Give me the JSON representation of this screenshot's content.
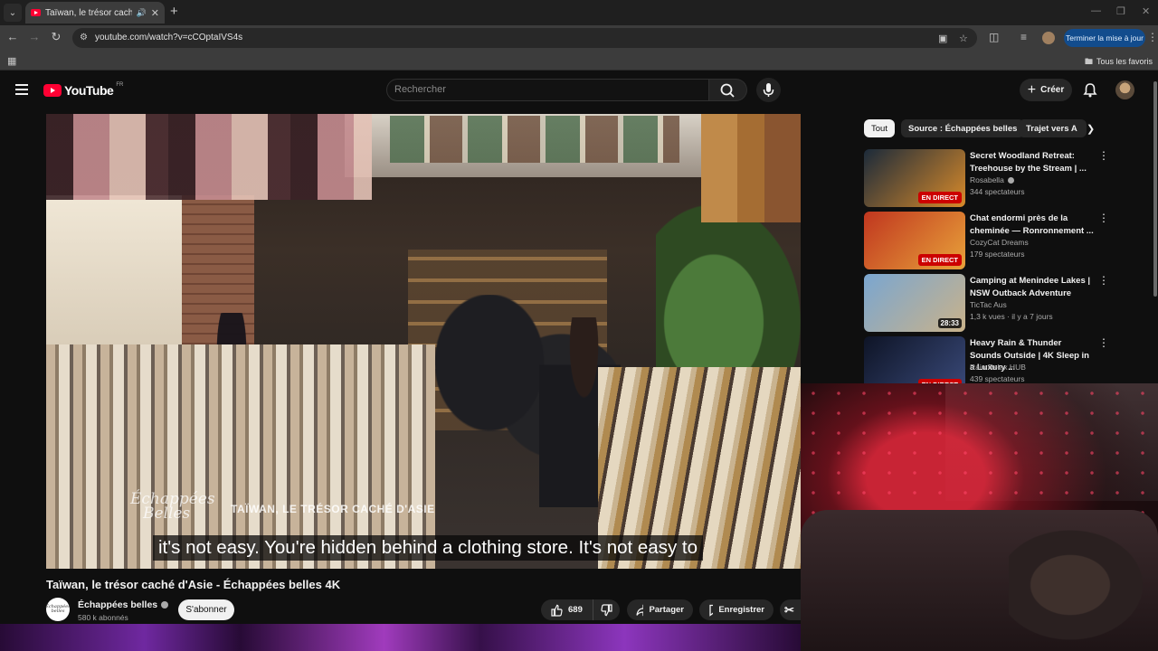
{
  "browser": {
    "tab_title": "Taïwan, le trésor caché d'Asie",
    "url": "youtube.com/watch?v=cCOptaIVS4s",
    "update_button": "Terminer la mise à jour",
    "all_bookmarks": "Tous les favoris"
  },
  "youtube": {
    "logo_text": "YouTube",
    "country": "FR",
    "search_placeholder": "Rechercher",
    "create_label": "Créer"
  },
  "video": {
    "overlay_logo_line1": "Échappées",
    "overlay_logo_line2": "Belles",
    "overlay_title": "TAÏWAN, LE TRÉSOR CACHÉ D'ASIE",
    "caption": "it's not easy. You're hidden behind a clothing store. It's not easy to",
    "title": "Taïwan, le trésor caché d'Asie - Échappées belles 4K",
    "channel_name": "Échappées belles",
    "channel_avatar_text": "Échappées belles",
    "subscribers": "580 k abonnés",
    "subscribe_label": "S'abonner",
    "like_count": "689",
    "share_label": "Partager",
    "save_label": "Enregistrer"
  },
  "chips": [
    "Tout",
    "Source : Échappées belles",
    "Trajet vers A"
  ],
  "recommendations": [
    {
      "title": "Secret Woodland Retreat: Treehouse by the Stream | ...",
      "channel": "Rosabella",
      "verified": true,
      "meta": "344 spectateurs",
      "badge": "EN DIRECT",
      "badge_type": "live",
      "thumb_colors": [
        "#1b2a3a",
        "#d88a2a"
      ]
    },
    {
      "title": "Chat endormi près de la cheminée — Ronronnement ...",
      "channel": "CozyCat Dreams",
      "verified": false,
      "meta": "179 spectateurs",
      "badge": "EN DIRECT",
      "badge_type": "live",
      "thumb_colors": [
        "#c0361f",
        "#e8a23a"
      ]
    },
    {
      "title": "Camping at Menindee Lakes | NSW Outback Adventure",
      "channel": "TicTac Aus",
      "verified": false,
      "meta": "1,3 k vues · il y a 7 jours",
      "badge": "28:33",
      "badge_type": "duration",
      "thumb_colors": [
        "#7aa6d0",
        "#c9b28a"
      ]
    },
    {
      "title": "Heavy Rain & Thunder Sounds Outside | 4K Sleep in a Luxury ...",
      "channel": "Rain Relax HUB",
      "verified": false,
      "meta": "439 spectateurs",
      "badge": "EN DIRECT",
      "badge_type": "live",
      "thumb_colors": [
        "#0e1426",
        "#3a4a7a"
      ]
    }
  ],
  "colors": {
    "yt_red": "#ff0033",
    "live_red": "#cc0000",
    "update_blue": "#124c8d"
  }
}
